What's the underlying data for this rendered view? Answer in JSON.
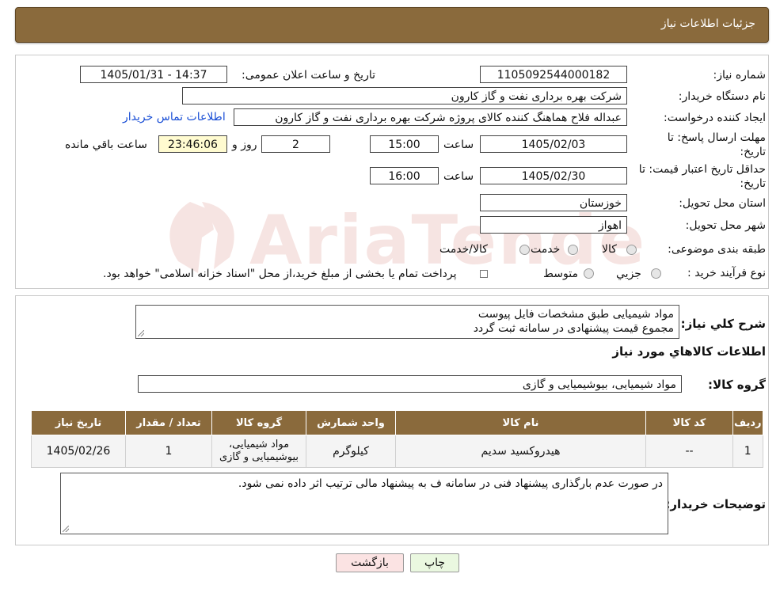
{
  "header": {
    "title": "جزئیات اطلاعات نیاز"
  },
  "form": {
    "need_number_label": "شماره نیاز:",
    "need_number": "1105092544000182",
    "announce_label": "تاریخ و ساعت اعلان عمومی:",
    "announce_value": "1405/01/31 - 14:37",
    "buyer_org_label": "نام دستگاه خریدار:",
    "buyer_org": "شرکت بهره برداری نفت و گاز کارون",
    "creator_label": "ایجاد کننده درخواست:",
    "creator": "عبداله فلاح هماهنگ کننده کالای پروژه شرکت بهره برداری نفت و گاز کارون",
    "contact_link": "اطلاعات تماس خریدار",
    "deadline_label": "مهلت ارسال پاسخ: تا تاریخ:",
    "deadline_date": "1405/02/03",
    "time_label": "ساعت",
    "deadline_time": "15:00",
    "days_value": "2",
    "days_label": "روز و",
    "remaining_time": "23:46:06",
    "remaining_label": "ساعت باقي مانده",
    "validity_label": "حداقل تاریخ اعتبار قیمت: تا تاریخ:",
    "validity_date": "1405/02/30",
    "validity_time": "16:00",
    "province_label": "استان محل تحویل:",
    "province": "خوزستان",
    "city_label": "شهر محل تحویل:",
    "city": "اهواز",
    "category_label": "طبقه بندی موضوعی:",
    "category_options": [
      "کالا",
      "خدمت",
      "کالا/خدمت"
    ],
    "purchase_label": "نوع فرآیند خرید :",
    "purchase_options": [
      "جزیي",
      "متوسط"
    ],
    "purchase_note": "پرداخت تمام یا بخشی از مبلغ خرید،از محل \"اسناد خزانه اسلامی\" خواهد بود."
  },
  "summary": {
    "label": "شرح کلي نياز:",
    "line1": "مواد شیمیایی طبق مشخصات فایل پیوست",
    "line2": "مجموع قیمت پیشنهادی در سامانه ثبت گردد"
  },
  "goods": {
    "section_title": "اطلاعات کالاهاي مورد نياز",
    "group_label": "گروه کالا:",
    "group_value": "مواد شیمیایی، بیوشیمیایی و  گازی",
    "columns": [
      "ردیف",
      "کد کالا",
      "نام کالا",
      "واحد شمارش",
      "گروه کالا",
      "تعداد / مقدار",
      "تاریخ نیاز"
    ],
    "rows": [
      [
        "1",
        "--",
        "هیدروکسید سدیم",
        "کیلوگرم",
        "مواد شیمیایی، بیوشیمیایی و گازی",
        "1",
        "1405/02/26"
      ]
    ]
  },
  "buyer_notes": {
    "label": "توضیحات خریدار:",
    "text": "در صورت عدم بارگذاری پیشنهاد فنی در سامانه ف به پیشنهاد مالی ترتیب اثر داده نمی شود."
  },
  "buttons": {
    "print": "چاپ",
    "back": "بازگشت"
  },
  "watermark": {
    "text": "AriaTender.neT"
  },
  "colors": {
    "header_bg": "#8a6a3c",
    "link": "#1a4fd6",
    "print_bg": "#eaf8e0",
    "back_bg": "#fbe3e3"
  }
}
